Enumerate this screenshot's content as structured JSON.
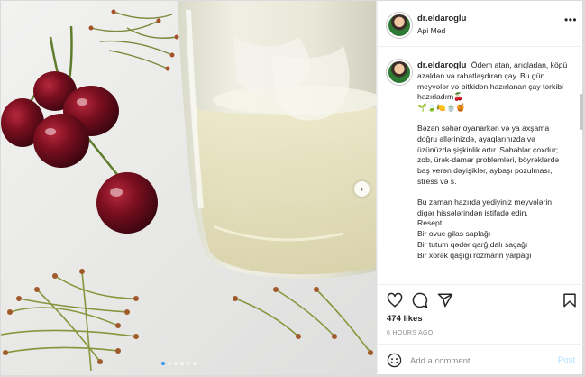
{
  "post": {
    "username": "dr.eldaroglu",
    "location": "Api Med",
    "more_icon": "more-horizontal-icon",
    "caption": {
      "username": "dr.eldaroglu",
      "intro": "Ödem atan, arıqladan, köpü azaldan və rahatlaşdıran çay. Bu gün meyvələr və bitkidən hazırlanan çay tərkibi hazırladım🍒",
      "emoji_line": "🌱🍃🍋🍵🍯",
      "paragraph_2": "Bəzən səhər oyanarkən və ya axşama doğru əllərinizdə, ayaqlarınızda və üzünüzdə şişkinlik artır. Səbəblər çoxdur; zob, ürək-damar problemləri, böyrəklərdə baş verən dəyişiklər, aybaşı pozulması, stress və s.",
      "paragraph_3": "Bu zaman hazırda yediyiniz meyvələrin digər hissələrindən istifadə edin.",
      "recipe_title": "Resept;",
      "recipe_items": [
        "Bir ovuc gilas saplağı",
        "Bir tutum qədər qarğıdalı saçağı",
        "Bir xörək qaşığı rozmarin yarpağı"
      ]
    },
    "likes": "474 likes",
    "time_ago": "6 HOURS AGO",
    "comment_placeholder": "Add a comment...",
    "post_button": "Post",
    "carousel": {
      "total": 6,
      "active": 1
    }
  },
  "icons": {
    "like": "heart-icon",
    "comment": "comment-icon",
    "share": "share-icon",
    "save": "bookmark-icon",
    "emoji": "emoji-icon",
    "next": "chevron-right-icon"
  },
  "colors": {
    "text": "#262626",
    "muted": "#8e8e8e",
    "border": "#efefef",
    "post_button_disabled": "#b2dffc",
    "cherry": "#7a0f1f",
    "carousel_active": "#3897f0"
  }
}
